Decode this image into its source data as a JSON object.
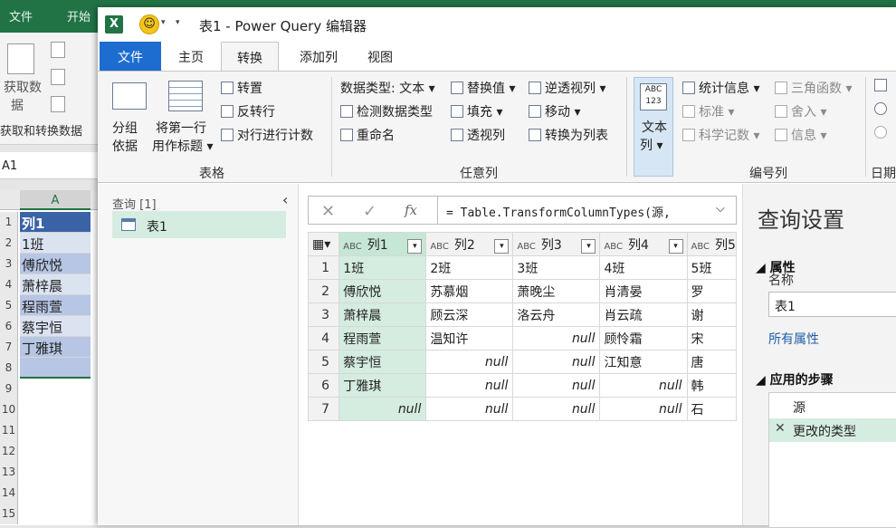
{
  "excel": {
    "tabs": [
      "文件",
      "开始"
    ],
    "ribbon_label_1": "获取数",
    "ribbon_label_2": "据",
    "group_label": "获取和转换数据",
    "namebox": "A1",
    "col_header": "A",
    "row_numbers": [
      "1",
      "2",
      "3",
      "4",
      "5",
      "6",
      "7",
      "8",
      "9",
      "10",
      "11",
      "12",
      "13",
      "14",
      "15"
    ],
    "cells": [
      "列1",
      "1班",
      "傅欣悦",
      "萧梓晨",
      "程雨萱",
      "蔡宇恒",
      "丁雅琪"
    ]
  },
  "window": {
    "title": "表1 - Power Query 编辑器",
    "logo": "X",
    "smiley": "☺"
  },
  "tabs": [
    "文件",
    "主页",
    "转换",
    "添加列",
    "视图"
  ],
  "ribbon": {
    "group_table": {
      "label": "表格",
      "group_by": [
        "分组",
        "依据"
      ],
      "first_row_header": [
        "将第一行",
        "用作标题 ▾"
      ],
      "transpose": "转置",
      "reverse_rows": "反转行",
      "count_rows": "对行进行计数"
    },
    "group_any_column": {
      "label": "任意列",
      "data_type": "数据类型: 文本 ▾",
      "detect_type": "检测数据类型",
      "rename": "重命名",
      "replace_values": "替换值 ▾",
      "fill": "填充 ▾",
      "pivot": "透视列",
      "unpivot": "逆透视列 ▾",
      "move": "移动 ▾",
      "convert_to_list": "转换为列表"
    },
    "text_column": [
      "文本",
      "列 ▾"
    ],
    "group_number": {
      "label": "编号列",
      "statistics": "统计信息 ▾",
      "standard": "标准 ▾",
      "scientific": "科学记数 ▾",
      "trig": "三角函数 ▾",
      "rounding": "舍入 ▾",
      "information": "信息 ▾"
    },
    "group_date_label": "日期"
  },
  "queries": {
    "header": "查询 [1]",
    "items": [
      "表1"
    ]
  },
  "formula": {
    "text": "= Table.TransformColumnTypes(源,",
    "cancel": "✕",
    "confirm": "✓",
    "fx": "fx"
  },
  "grid": {
    "columns": [
      "列1",
      "列2",
      "列3",
      "列4",
      "列5"
    ],
    "rows": [
      [
        "1",
        "1班",
        "2班",
        "3班",
        "4班",
        "5班"
      ],
      [
        "2",
        "傅欣悦",
        "苏慕烟",
        "萧晚尘",
        "肖清晏",
        "罗"
      ],
      [
        "3",
        "萧梓晨",
        "顾云深",
        "洛云舟",
        "肖云疏",
        "谢"
      ],
      [
        "4",
        "程雨萱",
        "温知许",
        "null",
        "顾怜霜",
        "宋"
      ],
      [
        "5",
        "蔡宇恒",
        "null",
        "null",
        "江知意",
        "唐"
      ],
      [
        "6",
        "丁雅琪",
        "null",
        "null",
        "null",
        "韩"
      ],
      [
        "7",
        "null",
        "null",
        "null",
        "null",
        "石"
      ]
    ]
  },
  "settings": {
    "title": "查询设置",
    "properties": "属性",
    "name_label": "名称",
    "name_value": "表1",
    "all_properties": "所有属性",
    "applied_steps": "应用的步骤",
    "steps": [
      "源",
      "更改的类型"
    ]
  }
}
